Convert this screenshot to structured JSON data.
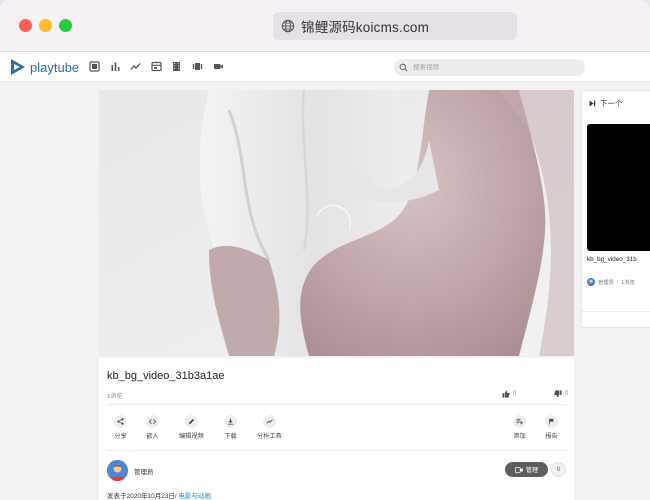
{
  "browser": {
    "url": "锦鲤源码koicms.com"
  },
  "site": {
    "logo_text": "playtube",
    "nav_icons": [
      "feed-icon",
      "bar-chart-icon",
      "trending-icon",
      "channels-icon",
      "film-icon",
      "shorts-icon",
      "video-camera-icon"
    ],
    "search_placeholder": "搜索视频"
  },
  "video": {
    "title": "kb_bg_video_31b3a1ae",
    "views": "1浏览",
    "likes": "0",
    "dislikes": "0"
  },
  "actions": {
    "share": "分享",
    "embed": "嵌入",
    "edit": "编辑视频",
    "download": "下载",
    "analytics": "分析工具",
    "add": "添加",
    "report": "报告"
  },
  "owner": {
    "name": "管理员",
    "manage_label": "管理",
    "manage_count": "0"
  },
  "published": {
    "prefix": "发表于2020年10月23日/",
    "category": "电影与动画"
  },
  "up_next": {
    "heading": "下一个",
    "title": "kb_bg_video_31b",
    "owner": "管理员",
    "views": "1浏览"
  },
  "colors": {
    "brand": "#2a6cb2",
    "category_link": "#2a86c8",
    "manage_button": "#5e5e5e"
  }
}
